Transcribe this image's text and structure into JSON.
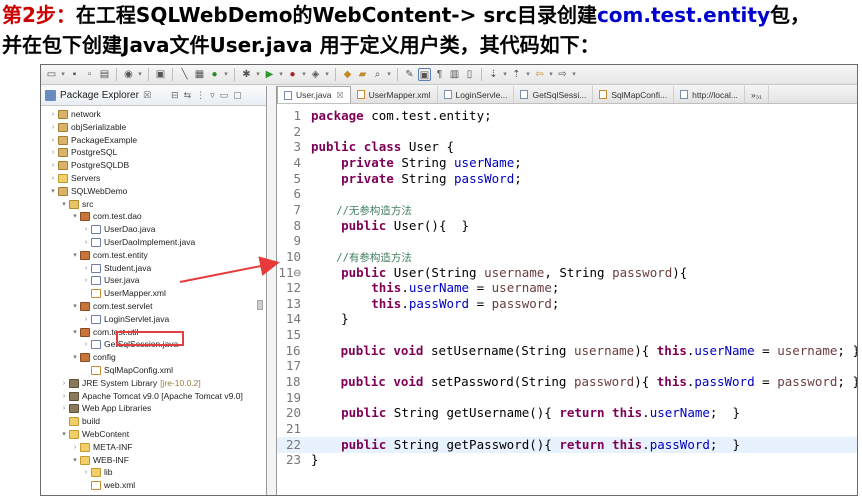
{
  "heading": {
    "step": "第2步：",
    "part1": "在工程SQLWebDemo的WebContent-> src目录创建",
    "package": "com.test.entity",
    "part2": "包，",
    "line2": "并在包下创建Java文件User.java 用于定义用户类，其代码如下："
  },
  "explorer": {
    "title": "Package Explorer",
    "items": [
      {
        "label": "network",
        "icon": "project-icon"
      },
      {
        "label": "objSerializable",
        "icon": "project-icon"
      },
      {
        "label": "PackageExample",
        "icon": "project-icon"
      },
      {
        "label": "PostgreSQL",
        "icon": "project-icon"
      },
      {
        "label": "PostgreSQLDB",
        "icon": "project-icon"
      },
      {
        "label": "Servers",
        "icon": "folder-icon"
      },
      {
        "label": "SQLWebDemo",
        "icon": "project-icon"
      },
      {
        "label": "src",
        "icon": "src-folder-icon"
      },
      {
        "label": "com.test.dao",
        "icon": "package-icon"
      },
      {
        "label": "UserDao.java",
        "icon": "java-file-icon"
      },
      {
        "label": "UserDaoImplement.java",
        "icon": "java-file-icon"
      },
      {
        "label": "com.test.entity",
        "icon": "package-icon"
      },
      {
        "label": "Student.java",
        "icon": "java-file-icon"
      },
      {
        "label": "User.java",
        "icon": "java-file-icon"
      },
      {
        "label": "UserMapper.xml",
        "icon": "xml-file-icon"
      },
      {
        "label": "com.test.servlet",
        "icon": "package-icon"
      },
      {
        "label": "LoginServlet.java",
        "icon": "java-file-icon"
      },
      {
        "label": "com.test.util",
        "icon": "package-icon"
      },
      {
        "label": "GetSqlSession.java",
        "icon": "java-file-icon"
      },
      {
        "label": "config",
        "icon": "package-icon"
      },
      {
        "label": "SqlMapConfig.xml",
        "icon": "xml-file-icon"
      },
      {
        "label": "JRE System Library",
        "extra": "[jre-10.0.2]",
        "icon": "library-icon"
      },
      {
        "label": "Apache Tomcat v9.0 [Apache Tomcat v9.0]",
        "icon": "library-icon"
      },
      {
        "label": "Web App Libraries",
        "icon": "library-icon"
      },
      {
        "label": "build",
        "icon": "folder-icon"
      },
      {
        "label": "WebContent",
        "icon": "folder-icon"
      },
      {
        "label": "META-INF",
        "icon": "folder-icon"
      },
      {
        "label": "WEB-INF",
        "icon": "folder-icon"
      },
      {
        "label": "lib",
        "icon": "folder-icon"
      },
      {
        "label": "web.xml",
        "icon": "xml-file-icon"
      }
    ]
  },
  "editor": {
    "tabs": [
      {
        "label": "User.java",
        "active": true,
        "close": "☒"
      },
      {
        "label": "UserMapper.xml"
      },
      {
        "label": "LoginServle..."
      },
      {
        "label": "GetSqlSessi..."
      },
      {
        "label": "SqlMapConfi..."
      },
      {
        "label": "http://local..."
      },
      {
        "label": "»₃₁"
      }
    ],
    "line_numbers": [
      "1",
      "2",
      "3",
      "4",
      "5",
      "6",
      "7",
      "8",
      "9",
      "10",
      "11⊖",
      "12",
      "13",
      "14",
      "15",
      "16",
      "17",
      "18",
      "19",
      "20",
      "21",
      "22",
      "23"
    ],
    "lines": [
      "package com.test.entity;",
      "",
      "public class User {",
      "    private String userName;",
      "    private String passWord;",
      "",
      "    //无参构造方法",
      "    public User(){  }",
      "",
      "    //有参构造方法",
      "    public User(String username, String password){",
      "        this.userName = username;",
      "        this.passWord = password;",
      "    }",
      "",
      "    public void setUsername(String username){ this.userName = username; }",
      "",
      "    public void setPassword(String password){ this.passWord = password; }",
      "",
      "    public String getUsername(){ return this.userName;  }",
      "",
      "    public String getPassword(){ return this.passWord;  }",
      "}"
    ]
  }
}
